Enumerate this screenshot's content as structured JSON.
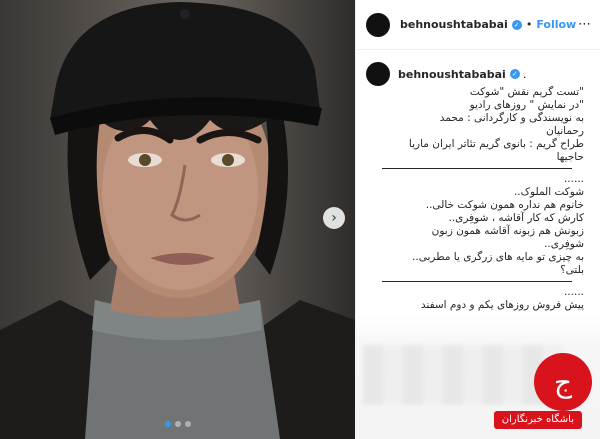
{
  "post": {
    "username": "behnoushtababai",
    "separator": "•",
    "follow_label": "Follow",
    "more_icon": "more-icon",
    "verified_icon": "verified-badge-icon"
  },
  "caption": {
    "username": "behnoushtababai",
    "suffix": ".",
    "lines": [
      "\"تست گریم نقش \"شوکت",
      "\"در نمایش \" روزهای رادیو",
      "به نویسندگی و کارگردانی : محمد",
      "رحمانیان",
      "طراح گریم : بانوی گریم تئاتر ایران ماریا",
      "حاجیها",
      "......",
      "شوکت الملوک..",
      "خانوم هم نداره همون شوکت خالی..",
      "کارش که کار آقاشه ، شوفِری..",
      "زبونش هم زبونه آقاشه همون زبون",
      "شوفِری..",
      "به چیزی تو مایه های زرگری یا مطربی..",
      "بلتی؟",
      "......",
      "پیش فروش روزهای یکم و دوم اسفند"
    ]
  },
  "carousel": {
    "next_label": "›",
    "dots": 3,
    "active_dot": 0
  },
  "watermark": {
    "logo_text": "ج",
    "site_text": "باشگاه خبرنگاران"
  }
}
